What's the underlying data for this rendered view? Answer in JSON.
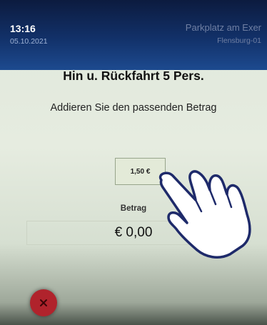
{
  "header": {
    "time": "13:16",
    "date": "05.10.2021",
    "location": "Parkplatz am Exer",
    "terminal": "Flensburg-01"
  },
  "main": {
    "title": "Hin u. Rückfahrt 5 Pers.",
    "instruction": "Addieren Sie den passenden Betrag",
    "coin_button_label": "1,50 €",
    "amount_label": "Betrag",
    "amount_value": "€ 0,00"
  },
  "footer": {
    "cancel_icon": "close-icon"
  },
  "colors": {
    "header_bg": "#123169",
    "screen_bg": "#e6ece0",
    "cancel": "#b0232c"
  }
}
